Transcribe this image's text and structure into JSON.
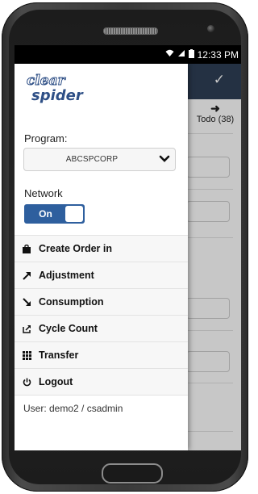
{
  "status_bar": {
    "time": "12:33 PM",
    "icons": [
      "wifi-icon",
      "signal-icon",
      "battery-icon"
    ]
  },
  "background": {
    "confirm_icon": "check-icon",
    "tab_label": "Todo (38)",
    "tab_icon": "arrow-right-icon",
    "header_color": "#2f3f56"
  },
  "drawer": {
    "logo": {
      "line1": "clear",
      "line2": "spider"
    },
    "program_label": "Program:",
    "program_value": "ABCSPCORP",
    "network_label": "Network",
    "network_toggle": {
      "label": "On",
      "state": true
    },
    "menu": [
      {
        "label": "Create Order in",
        "icon": "bag-icon"
      },
      {
        "label": "Adjustment",
        "icon": "arrow-up-right-icon"
      },
      {
        "label": "Consumption",
        "icon": "arrow-down-right-icon"
      },
      {
        "label": "Cycle Count",
        "icon": "share-icon"
      },
      {
        "label": "Transfer",
        "icon": "grid-icon"
      },
      {
        "label": "Logout",
        "icon": "power-icon"
      }
    ],
    "user_text": "User: demo2 / csadmin",
    "accent_color": "#2e5f9e"
  }
}
